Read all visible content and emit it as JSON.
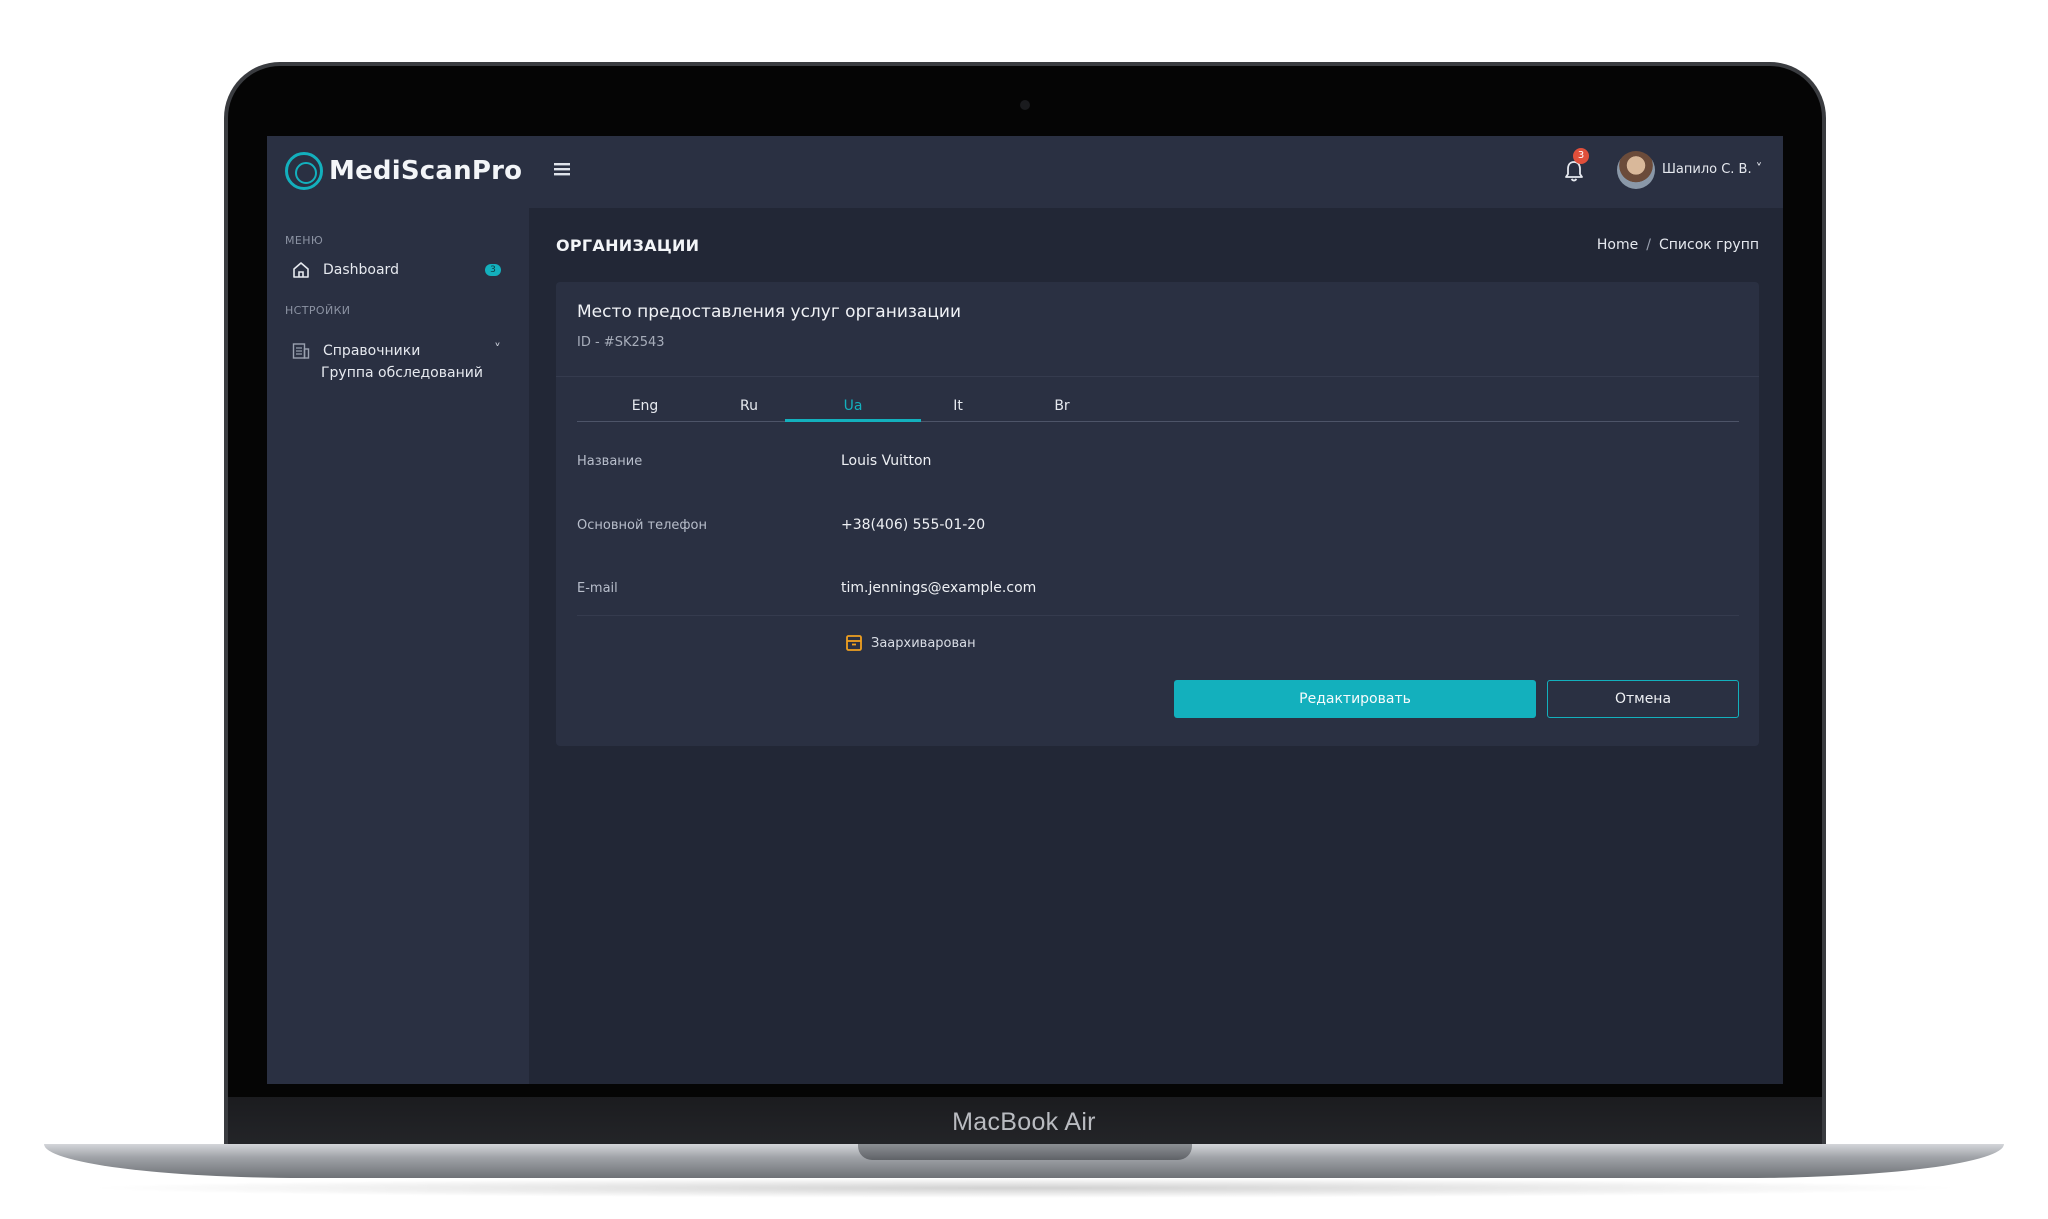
{
  "device": {
    "model_label": "MacBook Air"
  },
  "header": {
    "logo_text": "MediScanPro",
    "menu_icon": "hamburger-icon",
    "notifications": {
      "icon": "bell-icon",
      "count": "3"
    },
    "user": {
      "name": "Шапило С. В. ˅"
    }
  },
  "sidebar": {
    "section_menu": "МЕНЮ",
    "dashboard": {
      "label": "Dashboard",
      "badge": "3",
      "icon": "home-icon"
    },
    "section_settings": "НСТРОЙКИ",
    "directories": {
      "label": "Справочники",
      "icon": "directory-icon",
      "chevron": "˅"
    },
    "exam_groups": {
      "label": "Группа обследований"
    }
  },
  "page": {
    "title": "ОРГАНИЗАЦИИ",
    "breadcrumb": {
      "home": "Home",
      "separator": "/",
      "current": "Список групп"
    }
  },
  "card": {
    "title": "Место предоставления услуг организации",
    "id": "ID - #SK2543",
    "tabs": [
      {
        "label": "Eng"
      },
      {
        "label": "Ru"
      },
      {
        "label": "Ua"
      },
      {
        "label": "It"
      },
      {
        "label": "Br"
      }
    ],
    "active_tab": "Ua",
    "fields": {
      "name": {
        "label": "Название",
        "value": "Louis Vuitton"
      },
      "phone": {
        "label": "Основной телефон",
        "value": "+38(406) 555-01-20"
      },
      "email": {
        "label": "E-mail",
        "value": "tim.jennings@example.com"
      }
    },
    "archived": {
      "label": "Заархиварован",
      "icon": "archive-icon"
    },
    "buttons": {
      "edit": "Редактировать",
      "cancel": "Отмена"
    }
  },
  "colors": {
    "accent": "#13b0bd",
    "background": "#222736",
    "panel": "#2a3042",
    "badge_red": "#e04f3b",
    "archive_orange": "#f0a020"
  }
}
